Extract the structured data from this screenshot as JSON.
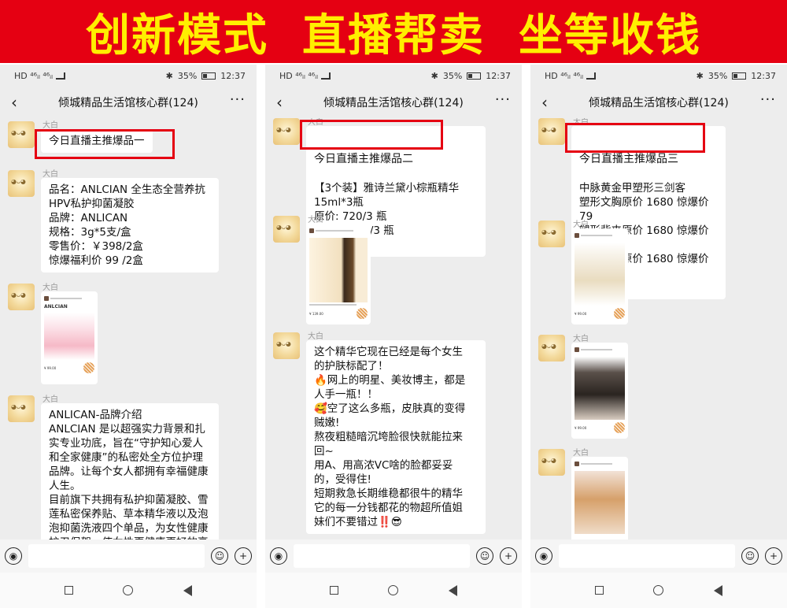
{
  "banner": {
    "text": "创新模式  直播帮卖  坐等收钱",
    "bg": "#e50012",
    "fg": "#ffef00"
  },
  "status": {
    "left": "HD ⁴⁶ᵢₗ ⁴⁶ᵢₗ",
    "battery": "35%",
    "time": "12:37"
  },
  "chat": {
    "title": "倾城精品生活馆核心群(124)"
  },
  "sender": "大白",
  "phone1": {
    "m1": "今日直播主推爆品一",
    "m2": "品名：ANLCIAN 全生态全营养抗\nHPV私护抑菌凝胶\n品牌：ANLICAN\n规格：3g*5支/盒\n零售价：￥398/2盒\n惊爆福利价 99 /2盒",
    "m3_card_brand": "ANLCIAN",
    "m3_card_price": "¥ 99.00",
    "m4": "ANLICAN-品牌介绍\nANLCIAN 是以超强实力背景和扎\n实专业功底，旨在“守护知心爱人\n和全家健康”的私密处全方位护理\n品牌。让每个女人都拥有幸福健康\n人生。\n目前旗下共拥有私护抑菌凝胶、雪\n莲私密保养贴、草本精华液以及泡\n泡抑菌洗液四个单品，为女性健康\n护卫保驾，使女性更健康更好的享"
  },
  "phone2": {
    "m1": "今日直播主推爆品二",
    "m1_rest": "【3个装】雅诗兰黛小棕瓶精华\n15ml*3瓶\n原价: 720/3 瓶\n惊爆价:139/3 瓶",
    "m2_card_price": "¥ 139.00",
    "m3": "这个精华它现在已经是每个女生\n的护肤标配了！\n🔥网上的明星、美妆博主，都是\n人手一瓶！！\n🥰空了这么多瓶，皮肤真的变得\n贼嫩!\n熬夜粗糙暗沉垮脸很快就能拉来\n回~\n用A、用高浓VC啥的脸都妥妥\n的，受得住!\n短期救急长期维稳都很牛的精华\n它的每一分钱都花的物超所值姐\n妹们不要错过‼️😎"
  },
  "phone3": {
    "m1": "今日直播主推爆品三",
    "m1_rest": "中脉黄金甲塑形三剑客\n塑形文胸原价 1680 惊爆价 79\n塑形背夹原价 1680 惊爆价 99\n塑形短裤原价 1680 惊爆价 99",
    "card_price1": "¥ 99.00",
    "card_price2": "¥ 99.00"
  },
  "icons": {
    "voice": "voice-icon",
    "emoji": "emoji-icon",
    "plus": "plus-icon",
    "back": "back-icon",
    "more": "more-icon"
  }
}
